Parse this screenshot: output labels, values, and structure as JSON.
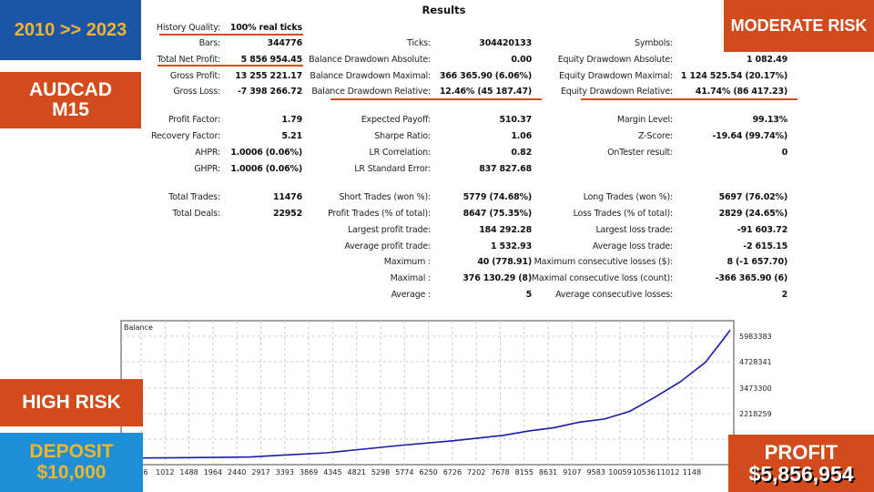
{
  "title": "Results",
  "rows": [
    {
      "top": 25,
      "cells": [
        {
          "label": "History Quality:",
          "value": "100% real ticks"
        }
      ]
    },
    {
      "top": 42,
      "cells": [
        {
          "label": "Bars:",
          "value": "344776"
        },
        {
          "label": "Ticks:",
          "value": "304420133"
        },
        {
          "label": "Symbols:",
          "value": ""
        }
      ]
    },
    {
      "top": 60,
      "cells": [
        {
          "label": "Total Net Profit:",
          "value": "5 856 954.45"
        },
        {
          "label": "Balance Drawdown Absolute:",
          "value": "0.00"
        },
        {
          "label": "Equity Drawdown Absolute:",
          "value": "1 082.49"
        }
      ]
    },
    {
      "top": 78,
      "cells": [
        {
          "label": "Gross Profit:",
          "value": "13 255 221.17"
        },
        {
          "label": "Balance Drawdown Maximal:",
          "value": "366 365.90 (6.06%)"
        },
        {
          "label": "Equity Drawdown Maximal:",
          "value": "1 124 525.54 (20.17%)"
        }
      ]
    },
    {
      "top": 95,
      "cells": [
        {
          "label": "Gross Loss:",
          "value": "-7 398 266.72"
        },
        {
          "label": "Balance Drawdown Relative:",
          "value": "12.46% (45 187.47)"
        },
        {
          "label": "Equity Drawdown Relative:",
          "value": "41.74% (86 417.23)"
        }
      ]
    },
    {
      "top": 126,
      "cells": [
        {
          "label": "Profit Factor:",
          "value": "1.79"
        },
        {
          "label": "Expected Payoff:",
          "value": "510.37"
        },
        {
          "label": "Margin Level:",
          "value": "99.13%"
        }
      ]
    },
    {
      "top": 144,
      "cells": [
        {
          "label": "Recovery Factor:",
          "value": "5.21"
        },
        {
          "label": "Sharpe Ratio:",
          "value": "1.06"
        },
        {
          "label": "Z-Score:",
          "value": "-19.64 (99.74%)"
        }
      ]
    },
    {
      "top": 162,
      "cells": [
        {
          "label": "AHPR:",
          "value": "1.0006 (0.06%)"
        },
        {
          "label": "LR Correlation:",
          "value": "0.82"
        },
        {
          "label": "OnTester result:",
          "value": "0"
        }
      ]
    },
    {
      "top": 180,
      "cells": [
        {
          "label": "GHPR:",
          "value": "1.0006 (0.06%)"
        },
        {
          "label": "LR Standard Error:",
          "value": "837 827.68"
        }
      ]
    },
    {
      "top": 211,
      "cells": [
        {
          "label": "Total Trades:",
          "value": "11476"
        },
        {
          "label": "Short Trades (won %):",
          "value": "5779 (74.68%)"
        },
        {
          "label": "Long Trades (won %):",
          "value": "5697 (76.02%)"
        }
      ]
    },
    {
      "top": 229,
      "cells": [
        {
          "label": "Total Deals:",
          "value": "22952"
        },
        {
          "label": "Profit Trades (% of total):",
          "value": "8647 (75.35%)"
        },
        {
          "label": "Loss Trades (% of total):",
          "value": "2829 (24.65%)"
        }
      ]
    },
    {
      "top": 247,
      "cells": [
        null,
        {
          "label": "Largest profit trade:",
          "value": "184 292.28"
        },
        {
          "label": "Largest loss trade:",
          "value": "-91 603.72"
        }
      ]
    },
    {
      "top": 265,
      "cells": [
        null,
        {
          "label": "Average profit trade:",
          "value": "1 532.93"
        },
        {
          "label": "Average loss trade:",
          "value": "-2 615.15"
        }
      ]
    },
    {
      "top": 282,
      "cells": [
        null,
        {
          "label": "Maximum :",
          "value": "40 (778.91)"
        },
        {
          "label": "Maximum consecutive losses ($):",
          "value": "8 (-1 657.70)"
        }
      ]
    },
    {
      "top": 300,
      "cells": [
        null,
        {
          "label": "Maximal :",
          "value": "376 130.29 (8)"
        },
        {
          "label": "Maximal consecutive loss (count):",
          "value": "-366 365.90 (6)"
        }
      ]
    },
    {
      "top": 318,
      "cells": [
        null,
        {
          "label": "Average :",
          "value": "5"
        },
        {
          "label": "Average consecutive losses:",
          "value": "2"
        }
      ]
    }
  ],
  "badges": {
    "period": "2010 >> 2023",
    "symbol_line1": "AUDCAD",
    "symbol_line2": "M15",
    "moderate_risk": "MODERATE RISK",
    "high_risk": "HIGH RISK",
    "deposit_label": "DEPOSIT",
    "deposit_value": "$10,000",
    "profit_label": "PROFIT",
    "profit_value": "$5,856,954"
  },
  "colors": {
    "orange": "#d24b1c",
    "blue_dark": "#1a55a8",
    "blue_light": "#1e8fd6",
    "yellow": "#f2b62c",
    "line": "#1a1aa8"
  },
  "chart_data": {
    "type": "line",
    "title": "Balance",
    "x_ticks": [
      "536",
      "1012",
      "1488",
      "1964",
      "2440",
      "2917",
      "3393",
      "3869",
      "4345",
      "4821",
      "5298",
      "5774",
      "6250",
      "6726",
      "7202",
      "7678",
      "8155",
      "8631",
      "9107",
      "9583",
      "10059",
      "10536",
      "11012",
      "1148"
    ],
    "y_ticks": [
      "5983383",
      "4728341",
      "3473300",
      "2218259"
    ],
    "grid": true,
    "series": [
      {
        "x": [
          0,
          1012,
          2440,
          2917,
          3869,
          5298,
          6250,
          7202,
          7678,
          8155,
          8631,
          9107,
          9583,
          10059,
          10536,
          11012,
          11300,
          11476
        ],
        "y": [
          10000,
          25000,
          60000,
          130000,
          250000,
          600000,
          800000,
          1050000,
          1250000,
          1400000,
          1650000,
          1800000,
          2150000,
          2800000,
          3500000,
          4400000,
          5300000,
          5866954
        ]
      }
    ],
    "xlim": [
      0,
      11476
    ],
    "ylim": [
      -291823,
      6300000
    ]
  }
}
